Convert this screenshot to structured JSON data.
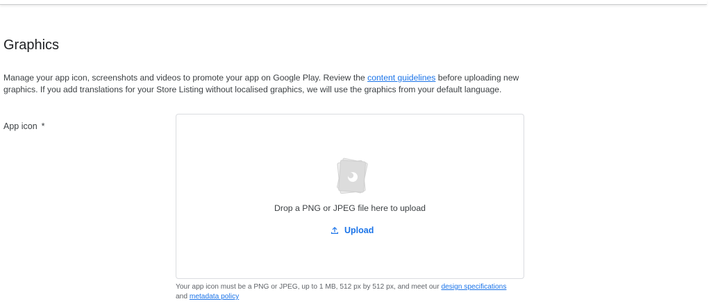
{
  "section": {
    "title": "Graphics",
    "intro_before_link": "Manage your app icon, screenshots and videos to promote your app on Google Play. Review the ",
    "intro_link": "content guidelines",
    "intro_after_link": " before uploading new graphics. If you add translations for your Store Listing without localised graphics, we will use the graphics from your default language."
  },
  "app_icon_field": {
    "label": "App icon",
    "required_marker": "*",
    "dropzone_text": "Drop a PNG or JPEG file here to upload",
    "upload_label": "Upload",
    "helper_before_link1": "Your app icon must be a PNG or JPEG, up to 1 MB, 512 px by 512 px, and meet our ",
    "helper_link1": "design specifications",
    "helper_between": " and ",
    "helper_link2": "metadata policy"
  },
  "icons": {
    "placeholder": "image-placeholder-icon",
    "upload": "upload-icon"
  },
  "colors": {
    "accent": "#1a73e8",
    "border": "#dadce0",
    "text": "#3c4043"
  }
}
